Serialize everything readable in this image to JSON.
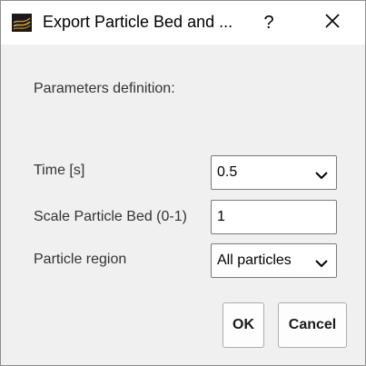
{
  "window": {
    "title": "Export Particle Bed and ...",
    "help_glyph": "?",
    "app_icon": "particle-bed-app-icon",
    "close_icon": "close-icon"
  },
  "form": {
    "section_label": "Parameters definition:",
    "time_label": "Time [s]",
    "time_value": "0.5",
    "scale_label": "Scale Particle Bed (0-1)",
    "scale_value": "1",
    "region_label": "Particle region",
    "region_value": "All particles"
  },
  "buttons": {
    "ok_label": "OK",
    "cancel_label": "Cancel"
  },
  "colors": {
    "dialog_bg": "#f0f0f0",
    "titlebar_bg": "#ffffff",
    "icon_gold": "#c8922a"
  }
}
